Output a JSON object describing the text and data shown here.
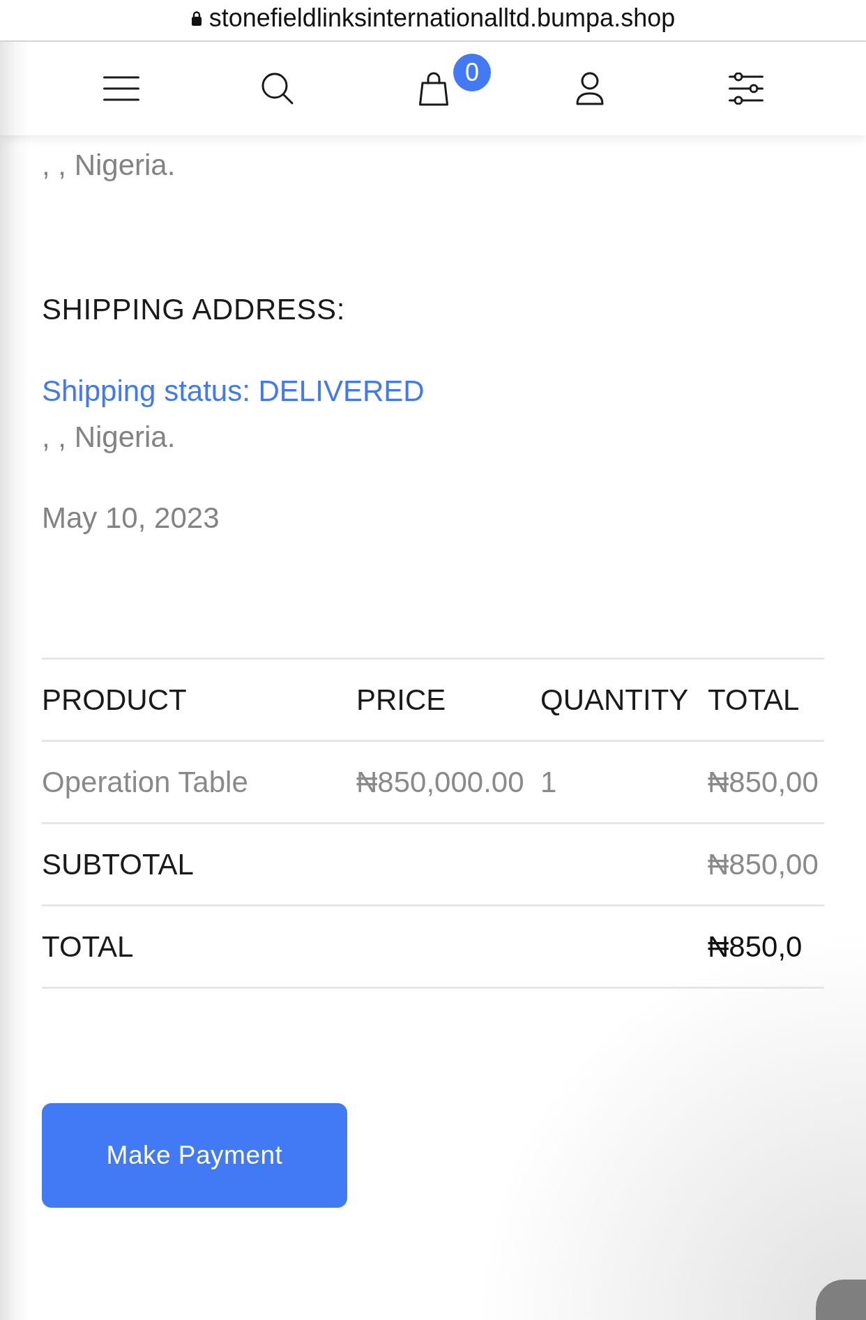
{
  "browser": {
    "url": "stonefieldlinksinternationalltd.bumpa.shop",
    "secure": true
  },
  "nav": {
    "cart_badge": "0"
  },
  "billing": {
    "address": ", , Nigeria."
  },
  "shipping": {
    "heading": "SHIPPING ADDRESS:",
    "status": "Shipping status: DELIVERED",
    "address": ", , Nigeria.",
    "date": "May 10, 2023"
  },
  "table": {
    "columns": [
      "PRODUCT",
      "PRICE",
      "QUANTITY",
      "TOTAL"
    ],
    "rows": [
      {
        "product": "Operation Table",
        "price": "₦850,000.00",
        "quantity": "1",
        "total": "₦850,00"
      }
    ]
  },
  "summary": [
    {
      "kind": "subtotal",
      "label": "SUBTOTAL",
      "value": "₦850,00"
    },
    {
      "kind": "total",
      "label": "TOTAL",
      "value": "₦850,0"
    }
  ],
  "button": {
    "label": "Make Payment"
  }
}
